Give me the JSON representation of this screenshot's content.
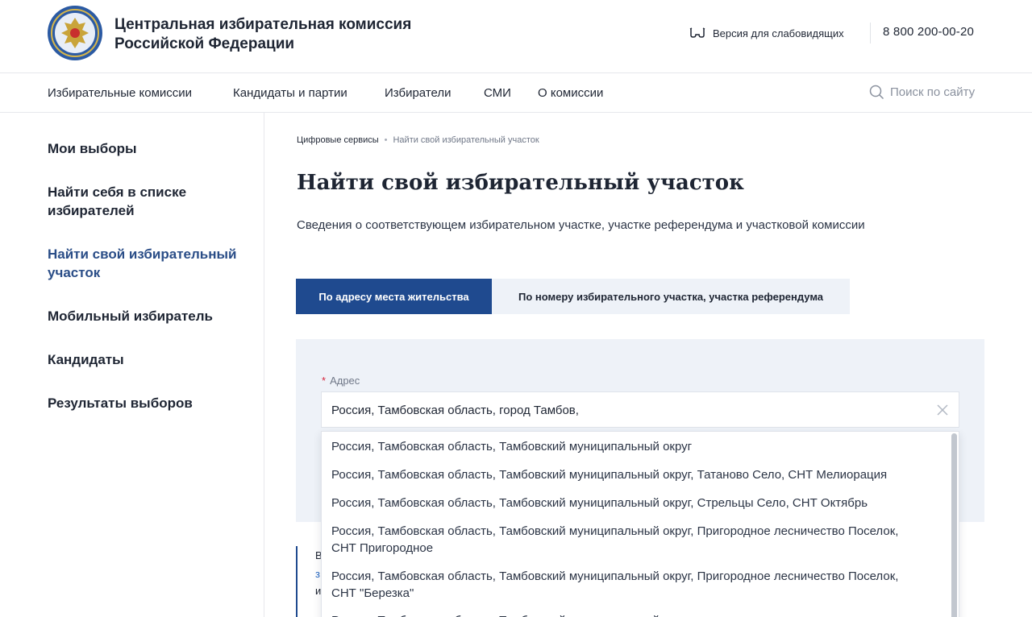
{
  "header": {
    "org_name_line1": "Центральная избирательная комиссия",
    "org_name_line2": "Российской Федерации",
    "low_vision_label": "Версия для слабовидящих",
    "phone": "8 800 200-00-20"
  },
  "nav": {
    "items": [
      "Избирательные комиссии",
      "Кандидаты и партии",
      "Избиратели",
      "СМИ",
      "О комиссии"
    ],
    "search_placeholder": "Поиск по сайту"
  },
  "sidebar": {
    "items": [
      "Мои выборы",
      "Найти себя в списке избирателей",
      "Найти свой избирательный участок",
      "Мобильный избиратель",
      "Кандидаты",
      "Результаты выборов"
    ],
    "active_index": 2
  },
  "breadcrumb": {
    "items": [
      "Цифровые сервисы",
      "Найти свой избирательный участок"
    ]
  },
  "main": {
    "title": "Найти свой избирательный участок",
    "subtitle": "Сведения о соответствующем избирательном участке, участке референдума и участковой комиссии"
  },
  "tabs": [
    {
      "label": "По адресу места жительства",
      "active": true
    },
    {
      "label": "По номеру избирательного участка, участка референдума",
      "active": false
    }
  ],
  "form": {
    "required_mark": "*",
    "address_label": "Адрес",
    "address_value": "Россия, Тамбовская область, город Тамбов,"
  },
  "suggestions": [
    "Россия, Тамбовская область, Тамбовский муниципальный округ",
    "Россия, Тамбовская область, Тамбовский муниципальный округ, Татаново Село, СНТ Мелиорация",
    "Россия, Тамбовская область, Тамбовский муниципальный округ, Стрельцы Село, СНТ Октябрь",
    "Россия, Тамбовская область, Тамбовский муниципальный округ, Пригородное лесничество Поселок, СНТ Пригородное",
    "Россия, Тамбовская область, Тамбовский муниципальный округ, Пригородное лесничество Поселок, СНТ \"Березка\""
  ],
  "info_fragments": [
    "В",
    "з",
    "и"
  ],
  "colors": {
    "accent": "#1f4a8f",
    "active_sidebar": "#2a4d87",
    "panel_bg": "#eef2f8",
    "required": "#d7263d"
  },
  "icons": {
    "logo": "emblem-logo",
    "low_vision": "glasses-icon",
    "search": "search-icon",
    "clear": "close-icon"
  }
}
